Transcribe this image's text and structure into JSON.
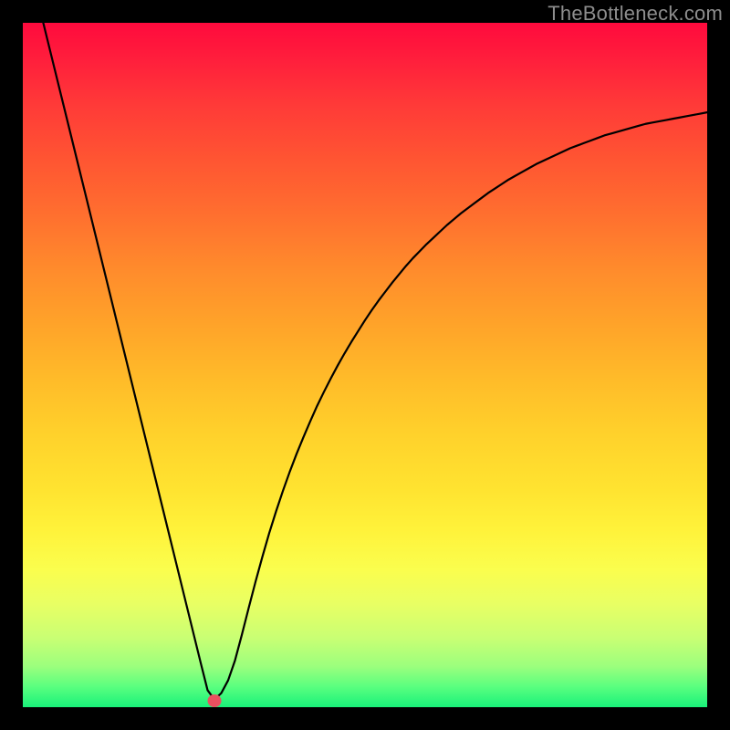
{
  "watermark": "TheBottleneck.com",
  "chart_data": {
    "type": "line",
    "title": "",
    "xlabel": "",
    "ylabel": "",
    "xlim": [
      0,
      100
    ],
    "ylim": [
      -2,
      105
    ],
    "x": [
      0,
      1,
      2,
      3,
      4,
      5,
      6,
      7,
      8,
      9,
      10,
      11,
      12,
      13,
      14,
      15,
      16,
      17,
      18,
      19,
      20,
      21,
      22,
      23,
      24,
      25,
      26,
      27,
      28,
      29,
      30,
      31,
      32,
      33,
      34,
      35,
      36,
      37,
      38,
      39,
      40,
      41,
      42,
      43,
      44,
      45,
      46,
      47,
      48,
      49,
      50,
      51,
      52,
      53,
      54,
      55,
      56,
      57,
      58,
      59,
      60,
      61,
      62,
      63,
      64,
      65,
      66,
      67,
      68,
      69,
      70,
      71,
      72,
      73,
      74,
      75,
      76,
      77,
      78,
      79,
      80,
      81,
      82,
      83,
      84,
      85,
      86,
      87,
      88,
      89,
      90,
      91,
      92,
      93,
      94,
      95,
      96,
      97,
      98,
      99,
      100
    ],
    "values": [
      118.0,
      113.65,
      109.3,
      104.95,
      100.6,
      96.25,
      91.9,
      87.55,
      83.2,
      78.85,
      74.5,
      70.15,
      65.8,
      61.45,
      57.1,
      52.75,
      48.4,
      44.05,
      39.7,
      35.35,
      31.0,
      26.65,
      22.3,
      17.95,
      13.6,
      9.25,
      4.9,
      0.65,
      -0.8,
      0.2,
      2.2,
      5.3,
      9.3,
      13.5,
      17.6,
      21.5,
      25.2,
      28.6,
      31.8,
      34.8,
      37.6,
      40.2,
      42.7,
      45.1,
      47.3,
      49.4,
      51.4,
      53.3,
      55.1,
      56.8,
      58.5,
      60.1,
      61.6,
      63.0,
      64.4,
      65.7,
      67.0,
      68.2,
      69.3,
      70.4,
      71.4,
      72.4,
      73.4,
      74.3,
      75.2,
      76.0,
      76.8,
      77.6,
      78.4,
      79.1,
      79.8,
      80.5,
      81.1,
      81.7,
      82.3,
      82.9,
      83.4,
      83.9,
      84.4,
      84.9,
      85.4,
      85.8,
      86.2,
      86.6,
      87.0,
      87.4,
      87.7,
      88.0,
      88.3,
      88.6,
      88.9,
      89.2,
      89.4,
      89.6,
      89.8,
      90.0,
      90.2,
      90.4,
      90.6,
      90.8,
      91.0
    ],
    "marker": {
      "shape": "segment",
      "color": "#ea5060",
      "x": 28,
      "y": -1,
      "width_x": 2.0,
      "height_y": 2.0
    },
    "background": "rainbow-vertical",
    "grid": false,
    "legend": false,
    "axis_ticks": false
  }
}
